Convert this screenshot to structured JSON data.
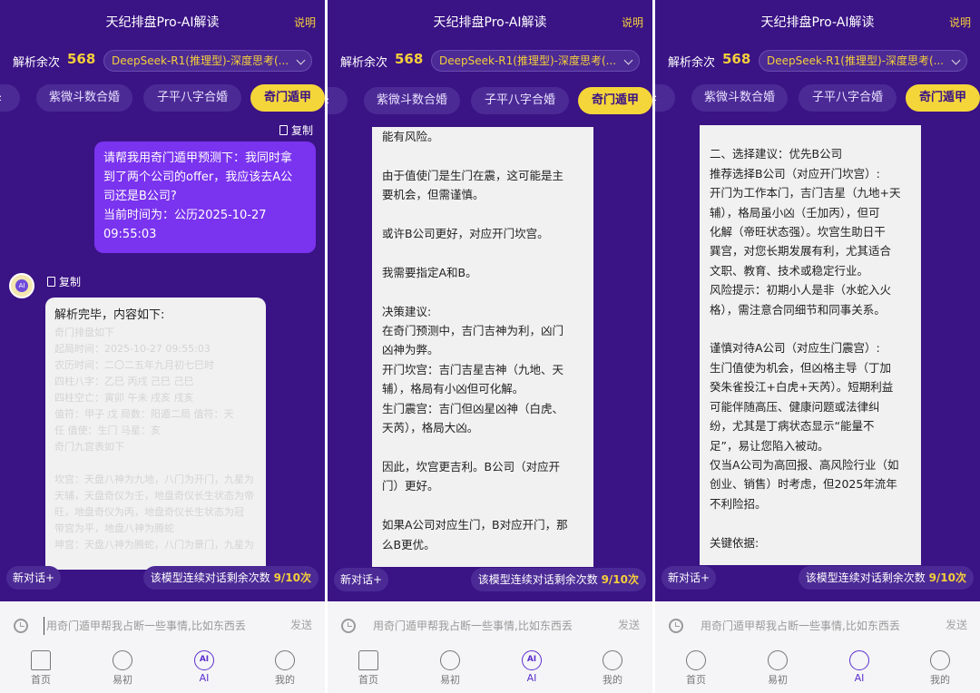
{
  "app": {
    "title": "天纪排盘Pro-AI解读",
    "help": "说明",
    "usage_label": "解析余次",
    "usage_count": "568",
    "model": "DeepSeek-R1(推理型)-深度思考(...",
    "tabs": [
      {
        "label": "≥"
      },
      {
        "label": "紫微斗数合婚"
      },
      {
        "label": "子平八字合婚"
      },
      {
        "label": "奇门遁甲"
      }
    ],
    "copy_label": "复制",
    "new_chat": "新对话+",
    "remaining_label": "该模型连续对话剩余次数",
    "remaining_value": "9/10次",
    "input_placeholder": "用奇门遁甲帮我占断一些事情,比如东西丢",
    "send_label": "发送",
    "nav": [
      {
        "label": "首页",
        "icon": "home-icon"
      },
      {
        "label": "易初",
        "icon": "yinyang-icon"
      },
      {
        "label": "AI",
        "icon": "ai-icon"
      },
      {
        "label": "我的",
        "icon": "profile-icon"
      }
    ]
  },
  "panel1": {
    "user_message": "请帮我用奇门遁甲预测下：我同时拿\n到了两个公司的offer，我应该去A公\n司还是B公司?\n当前时间为：公历2025-10-27\n09:55:03",
    "ai_first_line": "解析完毕，内容如下:",
    "ai_faint": "奇门排盘如下\n起局时间：2025-10-27 09:55:03\n农历时间：二〇二五年九月初七巳时\n四柱八字：乙巳 丙戌 己巳 己巳\n四柱空亡：寅卯 午未 戌亥 戌亥\n值符：甲子 戊  局数：阳遁二局  值符：天\n任  值使：生门  马星：亥\n奇门九宫表如下\n\n坎宫：天盘八神为九地，八门为开门，九星为\n天辅，天盘奇仪为壬，地盘奇仪长生状态为帝\n旺，地盘奇仪为丙，地盘奇仪长生状态为冠\n带宫为平，地盘八神为腾蛇\n坤宫：天盘八神为腾蛇，八门为景门，九星为"
  },
  "panel2": {
    "text": "能有风险。\n\n由于值使门是生门在震，这可能是主\n要机会，但需谨慎。\n\n或许B公司更好，对应开门坎宫。\n\n我需要指定A和B。\n\n决策建议:\n在奇门预测中，吉门吉神为利，凶门\n凶神为弊。\n开门坎宫：吉门吉星吉神（九地、天\n辅），格局有小凶但可化解。\n生门震宫：吉门但凶星凶神（白虎、\n天芮），格局大凶。\n\n因此，坎宫更吉利。B公司（对应开\n门）更好。\n\n如果A公司对应生门，B对应开门，那\n么B更优。"
  },
  "panel3": {
    "text": "\n二、选择建议：优先B公司\n推荐选择B公司（对应开门坎宫）:\n开门为工作本门，吉门吉星（九地+天\n辅），格局虽小凶（壬加丙），但可\n化解（帝旺状态强）。坎宫生助日干\n巽宫，对您长期发展有利，尤其适合\n文职、教育、技术或稳定行业。\n风险提示：初期小人是非（水蛇入火\n格），需注意合同细节和同事关系。\n\n谨慎对待A公司（对应生门震宫）:\n生门值使为机会，但凶格主导（丁加\n癸朱雀投江+白虎+天芮）。短期利益\n可能伴随高压、健康问题或法律纠\n纷，尤其是丁病状态显示“能量不\n足”，易让您陷入被动。\n仅当A公司为高回报、高风险行业（如\n创业、销售）时考虑，但2025年流年\n不利险招。\n\n关键依据:"
  }
}
